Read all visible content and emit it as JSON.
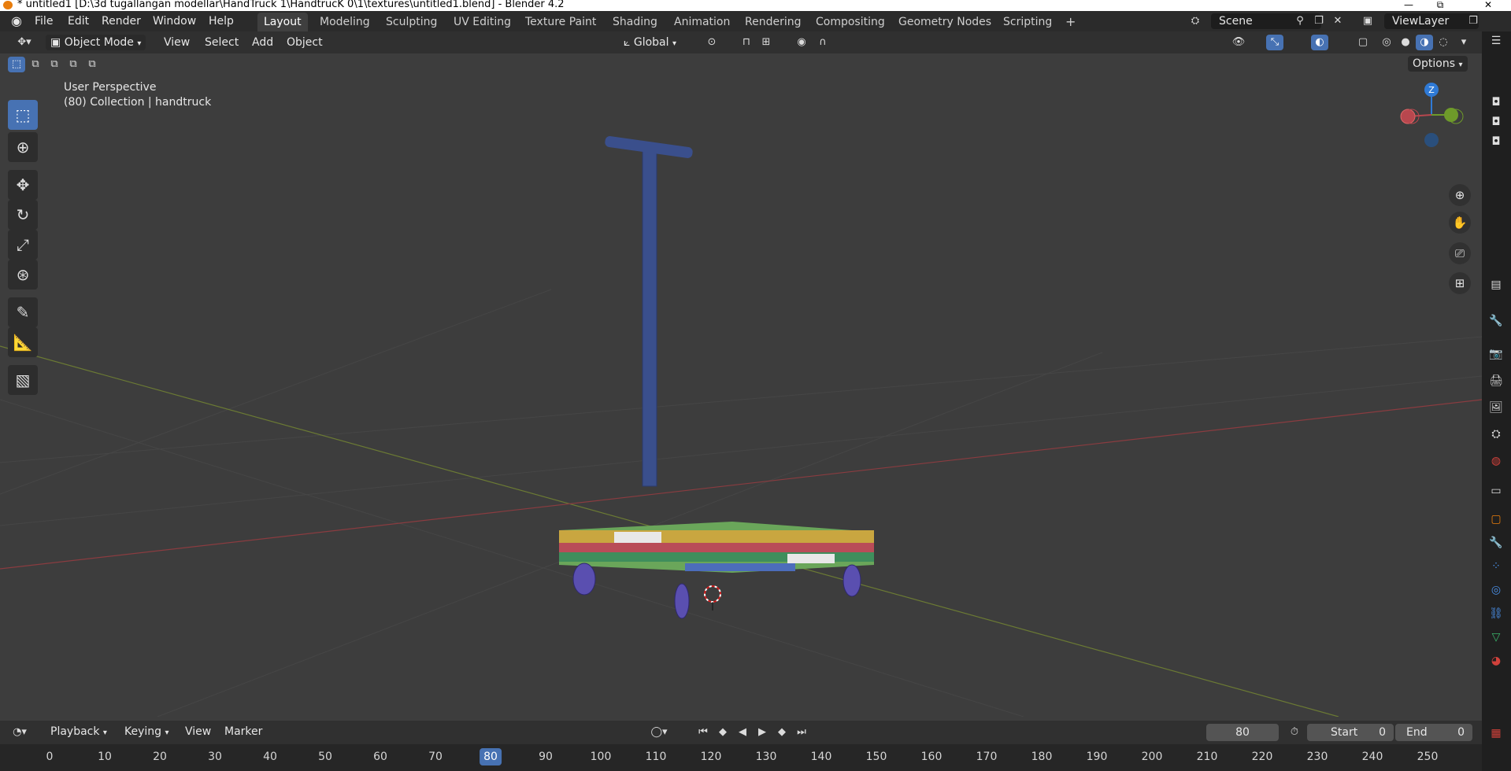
{
  "window": {
    "title": "* untitled1 [D:\\3d tugallangan modellar\\HandTruck 1\\HandtrucK 0\\1\\textures\\untitled1.blend] - Blender 4.2",
    "minimize": "—",
    "maximize": "⧉",
    "close": "✕"
  },
  "menu": [
    "File",
    "Edit",
    "Render",
    "Window",
    "Help"
  ],
  "workspaces": {
    "tabs": [
      "Layout",
      "Modeling",
      "Sculpting",
      "UV Editing",
      "Texture Paint",
      "Shading",
      "Animation",
      "Rendering",
      "Compositing",
      "Geometry Nodes",
      "Scripting"
    ],
    "active": "Layout",
    "add": "+"
  },
  "scene": {
    "name": "Scene",
    "view_layer": "ViewLayer"
  },
  "header": {
    "mode": "Object Mode",
    "menus": [
      "View",
      "Select",
      "Add",
      "Object"
    ],
    "transform_orientation": "Global",
    "options": "Options"
  },
  "viewport": {
    "perspective": "User Perspective",
    "collection_info": "(80) Collection | handtruck",
    "gizmo_z": "Z",
    "colors": {
      "x_axis": "#b8474e",
      "y_axis": "#6e9a2a",
      "z_axis": "#2f7ad6",
      "active": "#4772b3"
    }
  },
  "timeline": {
    "menus": [
      "Playback",
      "Keying",
      "View",
      "Marker"
    ],
    "current_frame": "80",
    "start_label": "Start",
    "start_value": "0",
    "end_label": "End",
    "end_value": "0",
    "ruler_ticks": [
      "0",
      "10",
      "20",
      "30",
      "40",
      "50",
      "60",
      "70",
      "80",
      "90",
      "100",
      "110",
      "120",
      "130",
      "140",
      "150",
      "160",
      "170",
      "180",
      "190",
      "200",
      "210",
      "220",
      "230",
      "240",
      "250"
    ],
    "playhead": "80"
  }
}
